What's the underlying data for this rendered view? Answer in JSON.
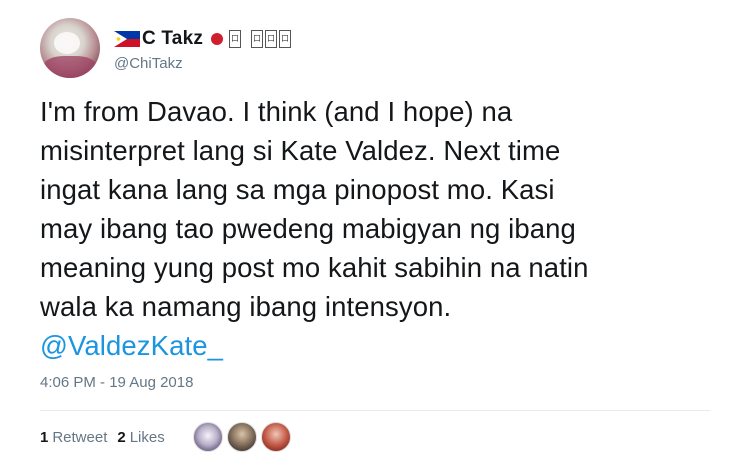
{
  "user": {
    "display_name": "C Takz",
    "handle": "@ChiTakz",
    "name_glyphs": [
      "口",
      "口",
      "口",
      "口"
    ]
  },
  "tweet": {
    "lines": [
      "I'm from Davao. I think (and I hope) na",
      "misinterpret lang si Kate Valdez. Next time",
      "ingat kana lang sa mga pinopost mo. Kasi",
      "may ibang tao pwedeng mabigyan ng ibang",
      "meaning yung post mo kahit sabihin na natin",
      "wala ka namang ibang intensyon."
    ],
    "mention": "@ValdezKate_",
    "timestamp": "4:06 PM - 19 Aug 2018"
  },
  "stats": {
    "retweets_count": "1",
    "retweets_label": "Retweet",
    "likes_count": "2",
    "likes_label": "Likes"
  },
  "colors": {
    "link": "#1b95e0",
    "secondary_text": "#657786",
    "primary_text": "#14171a",
    "divider": "#e6ecf0"
  }
}
